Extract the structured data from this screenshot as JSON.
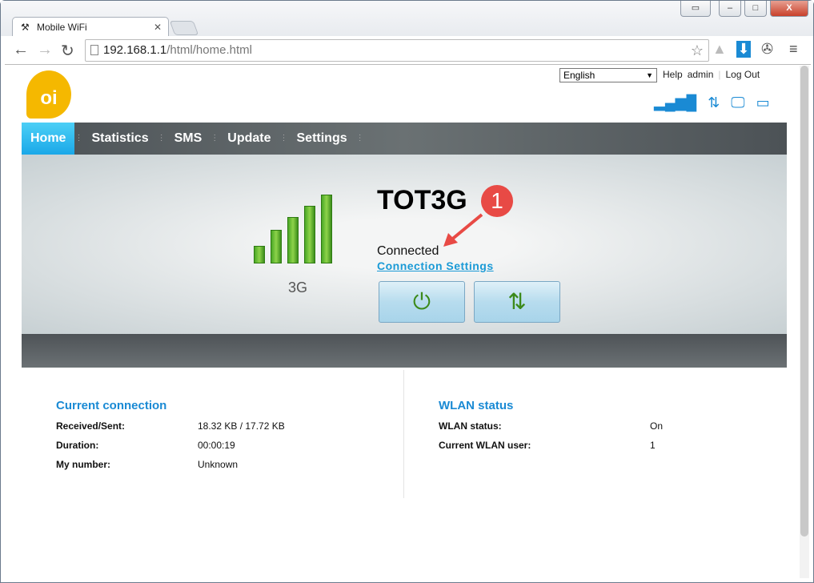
{
  "browser": {
    "tab_title": "Mobile WiFi",
    "url_host": "192.168.1.1",
    "url_path": "/html/home.html"
  },
  "header": {
    "language": "English",
    "help": "Help",
    "user": "admin",
    "logout": "Log Out",
    "logo_text": "oi"
  },
  "menu": [
    {
      "label": "Home",
      "active": true
    },
    {
      "label": "Statistics"
    },
    {
      "label": "SMS"
    },
    {
      "label": "Update"
    },
    {
      "label": "Settings"
    }
  ],
  "hero": {
    "network_type": "3G",
    "signal_level": 5,
    "signal_max": 5,
    "ssid": "TOT3G",
    "status": "Connected",
    "connection_settings": "Connection Settings",
    "annotation": "1",
    "accent": "#1a9ad6"
  },
  "current_connection": {
    "title": "Current connection",
    "rows": [
      {
        "label": "Received/Sent:",
        "value": "18.32 KB /  17.72 KB"
      },
      {
        "label": "Duration:",
        "value": "00:00:19"
      },
      {
        "label": "My number:",
        "value": "Unknown"
      }
    ]
  },
  "wlan": {
    "title": "WLAN status",
    "rows": [
      {
        "label": "WLAN status:",
        "value": "On"
      },
      {
        "label": "Current WLAN user:",
        "value": "1"
      }
    ]
  }
}
